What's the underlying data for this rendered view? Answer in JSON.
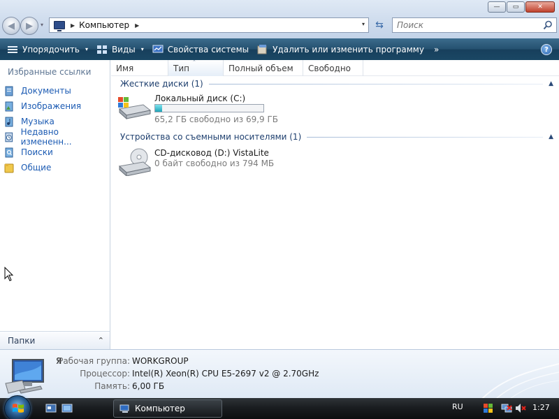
{
  "window_controls": {
    "minimize": "—",
    "maximize": "▭",
    "close": "✕"
  },
  "nav": {
    "back_glyph": "◀",
    "forward_glyph": "▶",
    "history_glyph": "▾"
  },
  "address": {
    "separator": "▶",
    "path": "Компьютер",
    "separator_after": "▶",
    "dropdown_glyph": "▾"
  },
  "refresh_glyph": "⇆",
  "search": {
    "placeholder": "Поиск"
  },
  "toolbar": {
    "organize": "Упорядочить",
    "views": "Виды",
    "system_properties": "Свойства системы",
    "uninstall": "Удалить или изменить программу",
    "more": "»",
    "dropdown_glyph": "▾",
    "help": "?"
  },
  "sidebar": {
    "heading": "Избранные ссылки",
    "items": [
      {
        "label": "Документы",
        "icon": "documents-icon"
      },
      {
        "label": "Изображения",
        "icon": "pictures-icon"
      },
      {
        "label": "Музыка",
        "icon": "music-icon"
      },
      {
        "label": "Недавно измененн...",
        "icon": "recent-icon"
      },
      {
        "label": "Поиски",
        "icon": "searches-icon"
      },
      {
        "label": "Общие",
        "icon": "public-folder-icon"
      }
    ],
    "folders_label": "Папки",
    "folders_chevron": "⌃"
  },
  "columns": [
    "Имя",
    "Тип",
    "Полный объем",
    "Свободно"
  ],
  "column_sort_glyph": "⌃",
  "groups": {
    "hard_disks": {
      "title": "Жесткие диски (1)",
      "collapse": "▲"
    },
    "removable": {
      "title": "Устройства со съемными носителями (1)",
      "collapse": "▲"
    }
  },
  "drives": {
    "c": {
      "name": "Локальный диск (C:)",
      "info": "65,2 ГБ свободно из 69,9 ГБ",
      "used_fraction": 0.067
    },
    "d": {
      "name": "CD-дисковод (D:) VistaLite",
      "info": "0 байт свободно из 794 МБ"
    }
  },
  "details": {
    "computer_name": "Я",
    "workgroup_label": "Рабочая группа:",
    "workgroup_value": "WORKGROUP",
    "processor_label": "Процессор:",
    "processor_value": "Intel(R) Xeon(R) CPU E5-2697 v2 @ 2.70GHz",
    "memory_label": "Память:",
    "memory_value": "6,00 ГБ"
  },
  "taskbar": {
    "task_label": "Компьютер",
    "language": "RU",
    "clock": "1:27"
  }
}
